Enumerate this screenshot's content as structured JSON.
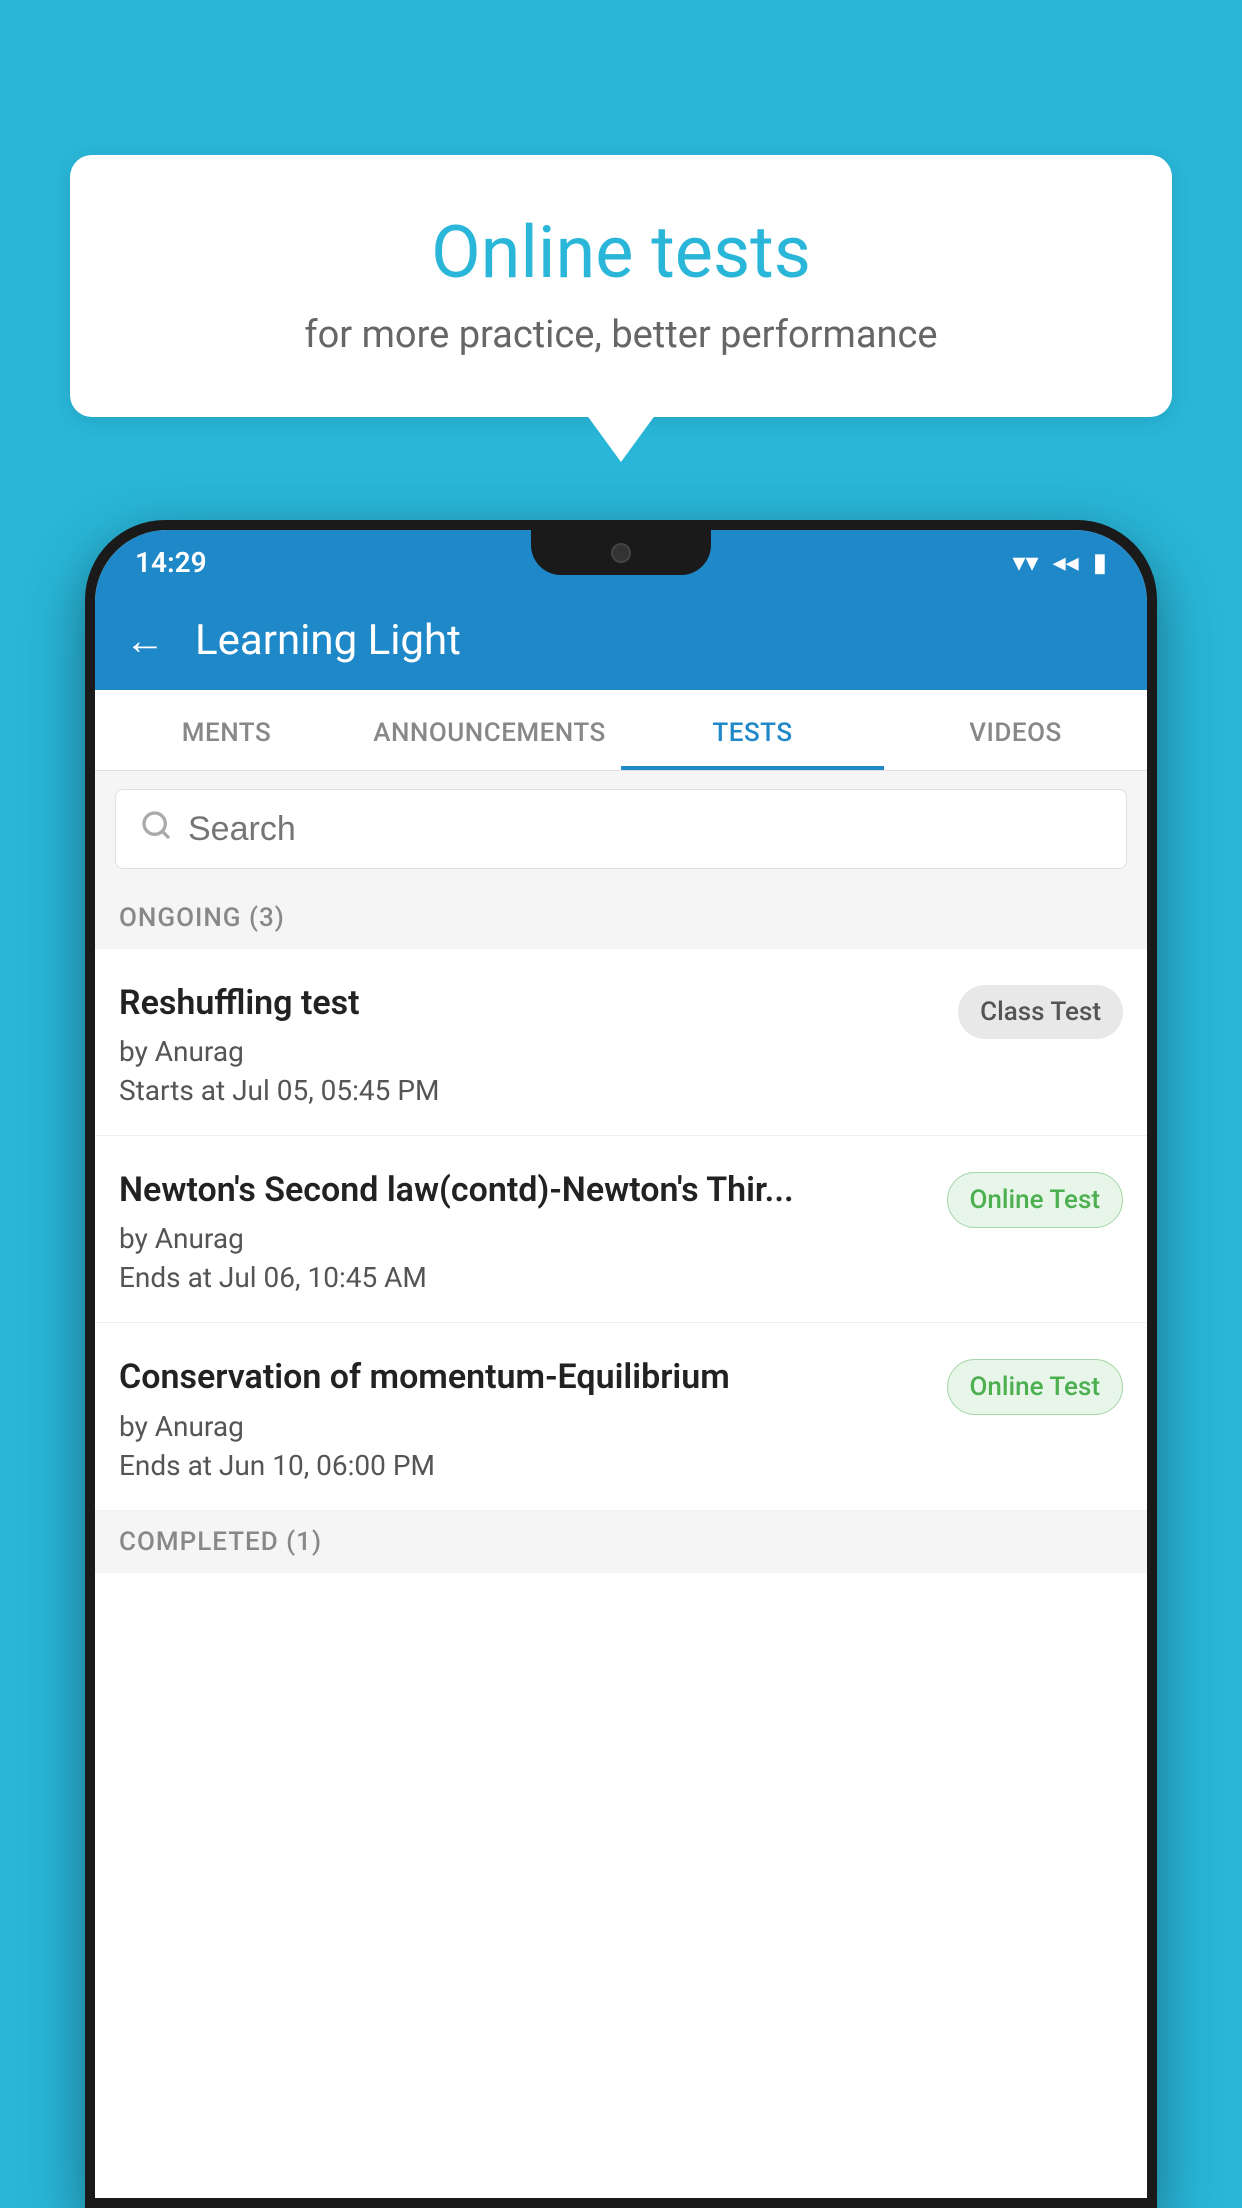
{
  "background": {
    "color": "#29b6d8"
  },
  "speech_bubble": {
    "title": "Online tests",
    "subtitle": "for more practice, better performance"
  },
  "phone": {
    "status_bar": {
      "time": "14:29",
      "wifi_icon": "▾",
      "signal_icon": "◂",
      "battery_icon": "▮"
    },
    "app_bar": {
      "back_label": "←",
      "title": "Learning Light"
    },
    "tabs": [
      {
        "label": "MENTS",
        "active": false
      },
      {
        "label": "ANNOUNCEMENTS",
        "active": false
      },
      {
        "label": "TESTS",
        "active": true
      },
      {
        "label": "VIDEOS",
        "active": false
      }
    ],
    "search": {
      "placeholder": "Search"
    },
    "ongoing_section": {
      "label": "ONGOING (3)"
    },
    "tests": [
      {
        "name": "Reshuffling test",
        "author": "by Anurag",
        "time_label": "Starts at",
        "time": "Jul 05, 05:45 PM",
        "badge": "Class Test",
        "badge_type": "class"
      },
      {
        "name": "Newton's Second law(contd)-Newton's Thir...",
        "author": "by Anurag",
        "time_label": "Ends at",
        "time": "Jul 06, 10:45 AM",
        "badge": "Online Test",
        "badge_type": "online"
      },
      {
        "name": "Conservation of momentum-Equilibrium",
        "author": "by Anurag",
        "time_label": "Ends at",
        "time": "Jun 10, 06:00 PM",
        "badge": "Online Test",
        "badge_type": "online"
      }
    ],
    "completed_section": {
      "label": "COMPLETED (1)"
    }
  }
}
